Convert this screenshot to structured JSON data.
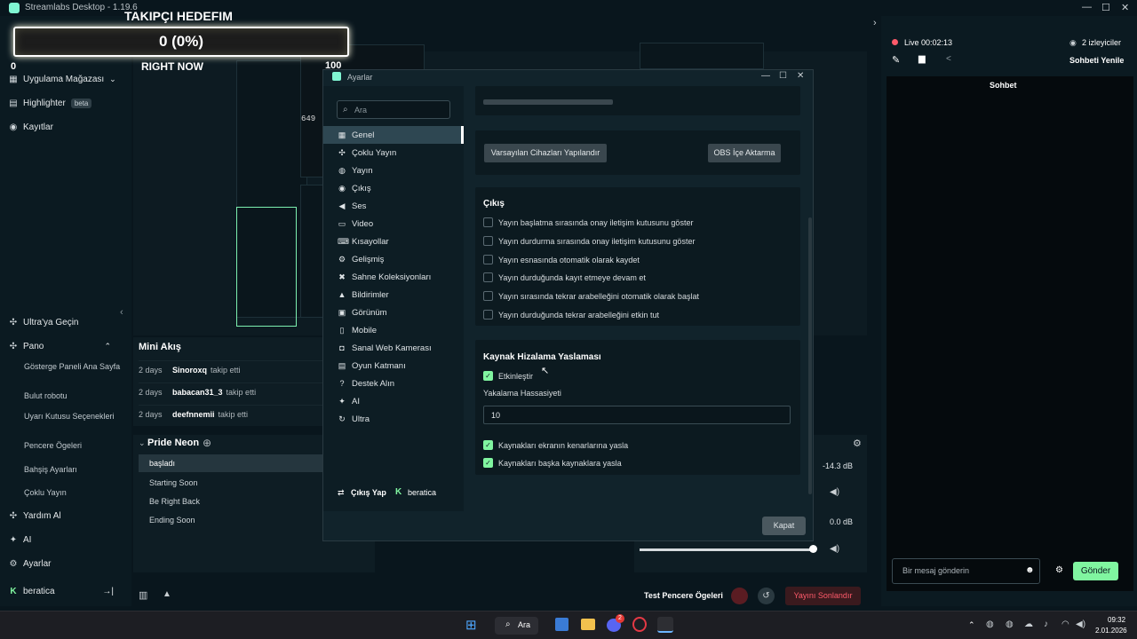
{
  "titlebar": {
    "title": "Streamlabs Desktop - 1.19.6"
  },
  "goal": {
    "title": "TAKIPÇI HEDEFIM",
    "value": "0 (0%)"
  },
  "preview": {
    "label": "RIGHT NOW",
    "count": "100",
    "zero": "0",
    "small_num": "649"
  },
  "leftnav": {
    "top_items": [
      {
        "label": "Uygulama Mağazası"
      },
      {
        "label": "Highlighter",
        "badge": "beta"
      },
      {
        "label": "Kayıtlar"
      }
    ],
    "ultra": "Ultra'ya Geçin",
    "pano": "Pano",
    "sub_items": [
      "Gösterge Paneli Ana Sayfa",
      "Bulut robotu",
      "Uyarı Kutusu Seçenekleri",
      "Pencere Ögeleri",
      "Bahşiş Ayarları",
      "Çoklu Yayın"
    ],
    "help": "Yardım Al",
    "ai": "AI",
    "settings": "Ayarlar",
    "user": "beratica"
  },
  "minifeed": {
    "title": "Mini Akış",
    "rows": [
      {
        "time": "2 days",
        "name": "Sinoroxq",
        "action": "takip etti"
      },
      {
        "time": "2 days",
        "name": "babacan31_3",
        "action": "takip etti"
      },
      {
        "time": "2 days",
        "name": "deefnnemii",
        "action": "takip etti"
      }
    ]
  },
  "scenes": {
    "title": "Pride Neon",
    "items": [
      "başladı",
      "Starting Soon",
      "Be Right Back",
      "Ending Soon"
    ]
  },
  "mixer": {
    "levels": [
      "-14.3 dB",
      "0.0 dB"
    ]
  },
  "chat": {
    "live": "Live 00:02:13",
    "viewers": "2 izleyiciler",
    "refresh": "Sohbeti Yenile",
    "title": "Sohbet",
    "placeholder": "Bir mesaj gönderin",
    "send": "Gönder"
  },
  "bottombar": {
    "test": "Test Pencere Ögeleri",
    "end": "Yayını Sonlandır"
  },
  "taskbar": {
    "search": "Ara",
    "time": "09:32",
    "date": "2.01.2026",
    "badge": "2"
  },
  "modal": {
    "title": "Ayarlar",
    "search_placeholder": "Ara",
    "menu": [
      {
        "label": "Genel",
        "icon": "grid-icon",
        "glyph": "▦"
      },
      {
        "label": "Çoklu Yayın",
        "icon": "multistream-icon",
        "glyph": "✣"
      },
      {
        "label": "Yayın",
        "icon": "globe-icon",
        "glyph": "◍"
      },
      {
        "label": "Çıkış",
        "icon": "output-icon",
        "glyph": "◉"
      },
      {
        "label": "Ses",
        "icon": "speaker-icon",
        "glyph": "◀"
      },
      {
        "label": "Video",
        "icon": "monitor-icon",
        "glyph": "▭"
      },
      {
        "label": "Kısayollar",
        "icon": "keyboard-icon",
        "glyph": "⌨"
      },
      {
        "label": "Gelişmiş",
        "icon": "gears-icon",
        "glyph": "⚙"
      },
      {
        "label": "Sahne Koleksiyonları",
        "icon": "collections-icon",
        "glyph": "✖"
      },
      {
        "label": "Bildirimler",
        "icon": "bell-icon",
        "glyph": "▲"
      },
      {
        "label": "Görünüm",
        "icon": "appearance-icon",
        "glyph": "▣"
      },
      {
        "label": "Mobile",
        "icon": "mobile-icon",
        "glyph": "▯"
      },
      {
        "label": "Sanal Web Kamerası",
        "icon": "camera-icon",
        "glyph": "◘"
      },
      {
        "label": "Oyun Katmanı",
        "icon": "overlay-icon",
        "glyph": "▤"
      },
      {
        "label": "Destek Alın",
        "icon": "help-icon",
        "glyph": "?"
      },
      {
        "label": "AI",
        "icon": "sparkle-icon",
        "glyph": "✦"
      },
      {
        "label": "Ultra",
        "icon": "ultra-icon",
        "glyph": "↻"
      }
    ],
    "logout": "Çıkış Yap",
    "username": "beratica",
    "btn_devices": "Varsayılan Cihazları Yapılandır",
    "btn_obs": "OBS İçe Aktarma",
    "output": {
      "title": "Çıkış",
      "options": [
        {
          "label": "Yayın başlatma sırasında onay iletişim kutusunu göster",
          "checked": false
        },
        {
          "label": "Yayın durdurma sırasında onay iletişim kutusunu göster",
          "checked": false
        },
        {
          "label": "Yayın esnasında otomatik olarak kaydet",
          "checked": false
        },
        {
          "label": "Yayın durduğunda kayıt etmeye devam et",
          "checked": false
        },
        {
          "label": "Yayın sırasında tekrar arabelleğini otomatik olarak başlat",
          "checked": false
        },
        {
          "label": "Yayın durduğunda tekrar arabelleğini etkin tut",
          "checked": false
        }
      ]
    },
    "snap": {
      "title": "Kaynak Hizalama Yaslaması",
      "enable": "Etkinleştir",
      "sens_label": "Yakalama Hassasiyeti",
      "sens_value": "10",
      "edge": "Kaynakları ekranın kenarlarına yasla",
      "other": "Kaynakları başka kaynaklara yasla"
    },
    "close": "Kapat"
  },
  "colors": {
    "accent": "#80f5a0",
    "danger": "#ff5a6a",
    "bg": "#09161d"
  }
}
